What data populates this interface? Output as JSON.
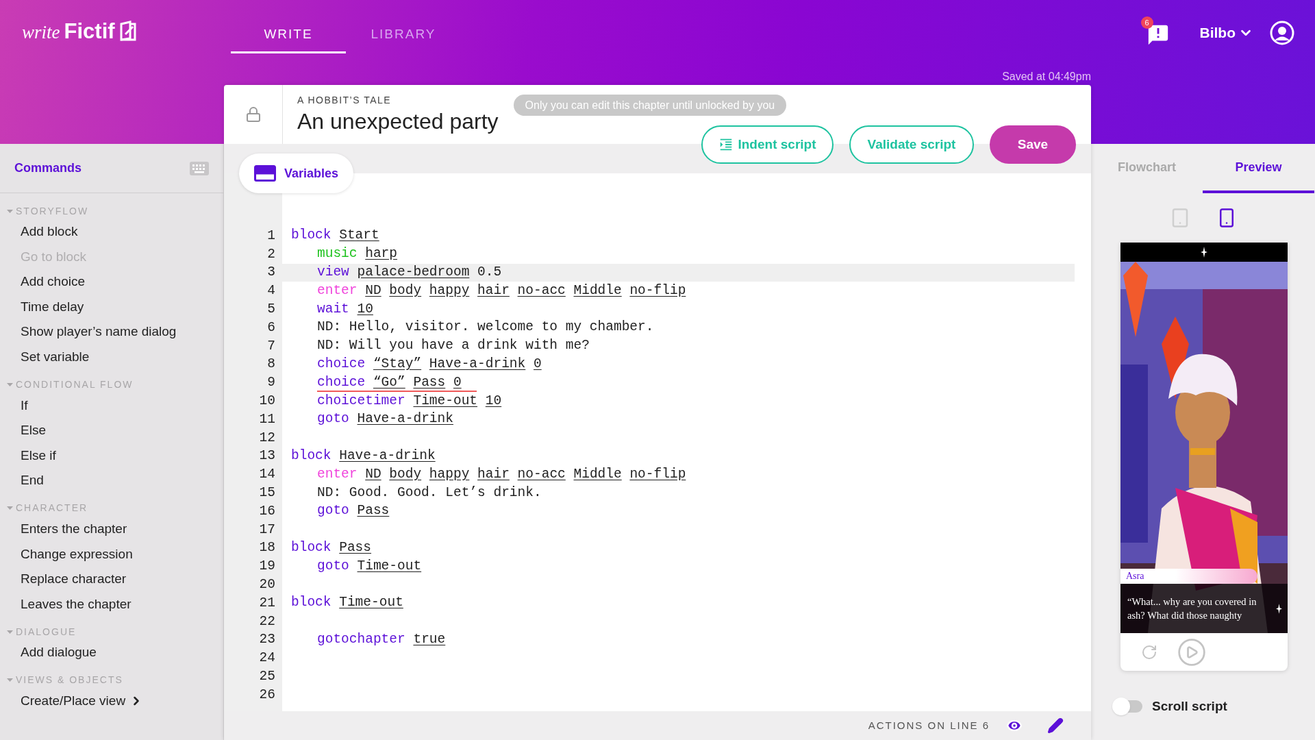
{
  "header": {
    "logo": {
      "script": "write",
      "name": "Fictif"
    },
    "tabs": [
      {
        "label": "WRITE",
        "selected": true
      },
      {
        "label": "LIBRARY",
        "selected": false
      }
    ],
    "notifications": {
      "count": "6"
    },
    "user": {
      "name": "Bilbo"
    },
    "saved": "Saved at 04:49pm"
  },
  "chapter": {
    "story": "A HOBBIT’S TALE",
    "title": "An unexpected party",
    "notice": "Only you can edit this chapter until unlocked by you",
    "buttons": [
      {
        "label": "Indent script",
        "kind": "indent"
      },
      {
        "label": "Validate script",
        "kind": "outline"
      },
      {
        "label": "Save",
        "kind": "primary"
      }
    ],
    "variables_button": {
      "label": "Variables"
    }
  },
  "sidebar": {
    "title": "Commands",
    "sections": [
      {
        "title": "STORYFLOW",
        "expanded": true,
        "items": [
          {
            "label": "Add block",
            "disabled": false,
            "submenu": false
          },
          {
            "label": "Go to block",
            "disabled": true,
            "submenu": false
          },
          {
            "label": "Add choice",
            "disabled": false,
            "submenu": false
          },
          {
            "label": "Time delay",
            "disabled": false,
            "submenu": false
          },
          {
            "label": "Show player’s name dialog",
            "disabled": false,
            "submenu": false
          },
          {
            "label": "Set variable",
            "disabled": false,
            "submenu": false
          }
        ]
      },
      {
        "title": "CONDITIONAL FLOW",
        "expanded": true,
        "items": [
          {
            "label": "If",
            "disabled": false,
            "submenu": false
          },
          {
            "label": "Else",
            "disabled": false,
            "submenu": false
          },
          {
            "label": "Else if",
            "disabled": false,
            "submenu": false
          },
          {
            "label": "End",
            "disabled": false,
            "submenu": false
          }
        ]
      },
      {
        "title": "CHARACTER",
        "expanded": true,
        "items": [
          {
            "label": "Enters the chapter",
            "disabled": false,
            "submenu": false
          },
          {
            "label": "Change expression",
            "disabled": false,
            "submenu": false
          },
          {
            "label": "Replace character",
            "disabled": false,
            "submenu": false
          },
          {
            "label": "Leaves the chapter",
            "disabled": false,
            "submenu": false
          }
        ]
      },
      {
        "title": "DIALOGUE",
        "expanded": true,
        "items": [
          {
            "label": "Add dialogue",
            "disabled": false,
            "submenu": false
          }
        ]
      },
      {
        "title": "VIEWS & OBJECTS",
        "expanded": true,
        "items": [
          {
            "label": "Create/Place view",
            "disabled": false,
            "submenu": true
          }
        ]
      }
    ]
  },
  "code": {
    "lines": [
      {
        "number": "1",
        "indent": false,
        "highlighted": false,
        "error": false,
        "tokens": [
          {
            "kind": "command",
            "text": "block",
            "color": "#5c10d8"
          },
          {
            "kind": "arg",
            "text": "Start"
          }
        ]
      },
      {
        "number": "2",
        "indent": true,
        "highlighted": false,
        "error": false,
        "tokens": [
          {
            "kind": "command",
            "text": "music",
            "color": "#1fc21f"
          },
          {
            "kind": "arg",
            "text": "harp"
          }
        ]
      },
      {
        "number": "3",
        "indent": true,
        "highlighted": true,
        "error": false,
        "tokens": [
          {
            "kind": "command",
            "text": "view",
            "color": "#5c10d8"
          },
          {
            "kind": "arg",
            "text": "palace-bedroom"
          },
          {
            "kind": "plain",
            "text": "0.5"
          }
        ]
      },
      {
        "number": "4",
        "indent": true,
        "highlighted": false,
        "error": false,
        "tokens": [
          {
            "kind": "command",
            "text": "enter",
            "color": "#f044dc"
          },
          {
            "kind": "arg",
            "text": "ND"
          },
          {
            "kind": "arg",
            "text": "body"
          },
          {
            "kind": "arg",
            "text": "happy"
          },
          {
            "kind": "arg",
            "text": "hair"
          },
          {
            "kind": "arg",
            "text": "no-acc"
          },
          {
            "kind": "arg",
            "text": "Middle"
          },
          {
            "kind": "arg",
            "text": "no-flip"
          }
        ]
      },
      {
        "number": "5",
        "indent": true,
        "highlighted": false,
        "error": false,
        "tokens": [
          {
            "kind": "command",
            "text": "wait",
            "color": "#5c10d8"
          },
          {
            "kind": "arg",
            "text": "10"
          }
        ]
      },
      {
        "number": "6",
        "indent": true,
        "highlighted": false,
        "error": false,
        "tokens": [
          {
            "kind": "plain",
            "text": "ND: Hello, visitor. welcome to my chamber."
          }
        ]
      },
      {
        "number": "7",
        "indent": true,
        "highlighted": false,
        "error": false,
        "tokens": [
          {
            "kind": "plain",
            "text": "ND: Will you have a drink with me?"
          }
        ]
      },
      {
        "number": "8",
        "indent": true,
        "highlighted": false,
        "error": false,
        "tokens": [
          {
            "kind": "command",
            "text": "choice",
            "color": "#5c10d8"
          },
          {
            "kind": "arg",
            "text": "“Stay”"
          },
          {
            "kind": "arg",
            "text": "Have-a-drink"
          },
          {
            "kind": "arg",
            "text": "0"
          }
        ]
      },
      {
        "number": "9",
        "indent": true,
        "highlighted": false,
        "error": true,
        "tokens": [
          {
            "kind": "command",
            "text": "choice",
            "color": "#5c10d8"
          },
          {
            "kind": "arg",
            "text": "“Go”"
          },
          {
            "kind": "arg",
            "text": "Pass"
          },
          {
            "kind": "arg",
            "text": "0"
          }
        ]
      },
      {
        "number": "10",
        "indent": true,
        "highlighted": false,
        "error": false,
        "tokens": [
          {
            "kind": "command",
            "text": "choicetimer",
            "color": "#5c10d8"
          },
          {
            "kind": "arg",
            "text": "Time-out"
          },
          {
            "kind": "arg",
            "text": "10"
          }
        ]
      },
      {
        "number": "11",
        "indent": true,
        "highlighted": false,
        "error": false,
        "tokens": [
          {
            "kind": "command",
            "text": "goto",
            "color": "#5c10d8"
          },
          {
            "kind": "arg",
            "text": "Have-a-drink"
          }
        ]
      },
      {
        "number": "12",
        "highlighted": false,
        "error": false
      },
      {
        "number": "13",
        "indent": false,
        "highlighted": false,
        "error": false,
        "tokens": [
          {
            "kind": "command",
            "text": "block",
            "color": "#5c10d8"
          },
          {
            "kind": "arg",
            "text": "Have-a-drink"
          }
        ]
      },
      {
        "number": "14",
        "indent": true,
        "highlighted": false,
        "error": false,
        "tokens": [
          {
            "kind": "command",
            "text": "enter",
            "color": "#f044dc"
          },
          {
            "kind": "arg",
            "text": "ND"
          },
          {
            "kind": "arg",
            "text": "body"
          },
          {
            "kind": "arg",
            "text": "happy"
          },
          {
            "kind": "arg",
            "text": "hair"
          },
          {
            "kind": "arg",
            "text": "no-acc"
          },
          {
            "kind": "arg",
            "text": "Middle"
          },
          {
            "kind": "arg",
            "text": "no-flip"
          }
        ]
      },
      {
        "number": "15",
        "indent": true,
        "highlighted": false,
        "error": false,
        "tokens": [
          {
            "kind": "plain",
            "text": "ND: Good. Good. Let’s drink."
          }
        ]
      },
      {
        "number": "16",
        "indent": true,
        "highlighted": false,
        "error": false,
        "tokens": [
          {
            "kind": "command",
            "text": "goto",
            "color": "#5c10d8"
          },
          {
            "kind": "arg",
            "text": "Pass"
          }
        ]
      },
      {
        "number": "17",
        "highlighted": false,
        "error": false
      },
      {
        "number": "18",
        "indent": false,
        "highlighted": false,
        "error": false,
        "tokens": [
          {
            "kind": "command",
            "text": "block",
            "color": "#5c10d8"
          },
          {
            "kind": "arg",
            "text": "Pass"
          }
        ]
      },
      {
        "number": "19",
        "indent": true,
        "highlighted": false,
        "error": false,
        "tokens": [
          {
            "kind": "command",
            "text": "goto",
            "color": "#5c10d8"
          },
          {
            "kind": "arg",
            "text": "Time-out"
          }
        ]
      },
      {
        "number": "20",
        "highlighted": false,
        "error": false
      },
      {
        "number": "21",
        "indent": false,
        "highlighted": false,
        "error": false,
        "tokens": [
          {
            "kind": "command",
            "text": "block",
            "color": "#5c10d8"
          },
          {
            "kind": "arg",
            "text": "Time-out"
          }
        ]
      },
      {
        "number": "22",
        "highlighted": false,
        "error": false
      },
      {
        "number": "23",
        "indent": true,
        "highlighted": false,
        "error": false,
        "tokens": [
          {
            "kind": "command",
            "text": "gotochapter",
            "color": "#5c10d8"
          },
          {
            "kind": "arg",
            "text": "true"
          }
        ]
      },
      {
        "number": "24",
        "highlighted": false,
        "error": false
      },
      {
        "number": "25",
        "highlighted": false,
        "error": false
      },
      {
        "number": "26",
        "highlighted": false,
        "error": false
      }
    ]
  },
  "status_bar": {
    "text": "ACTIONS ON LINE 6"
  },
  "preview": {
    "tabs": [
      {
        "label": "Flowchart",
        "selected": false
      },
      {
        "label": "Preview",
        "selected": true
      }
    ],
    "devices": [
      {
        "kind": "tablet",
        "selected": false
      },
      {
        "kind": "phone",
        "selected": true
      }
    ],
    "screen": {
      "speaker": "Asra",
      "dialogue": "“What... why are you covered in ash? What did those naughty"
    },
    "scroll_script": {
      "label": "Scroll script",
      "on": false
    }
  }
}
